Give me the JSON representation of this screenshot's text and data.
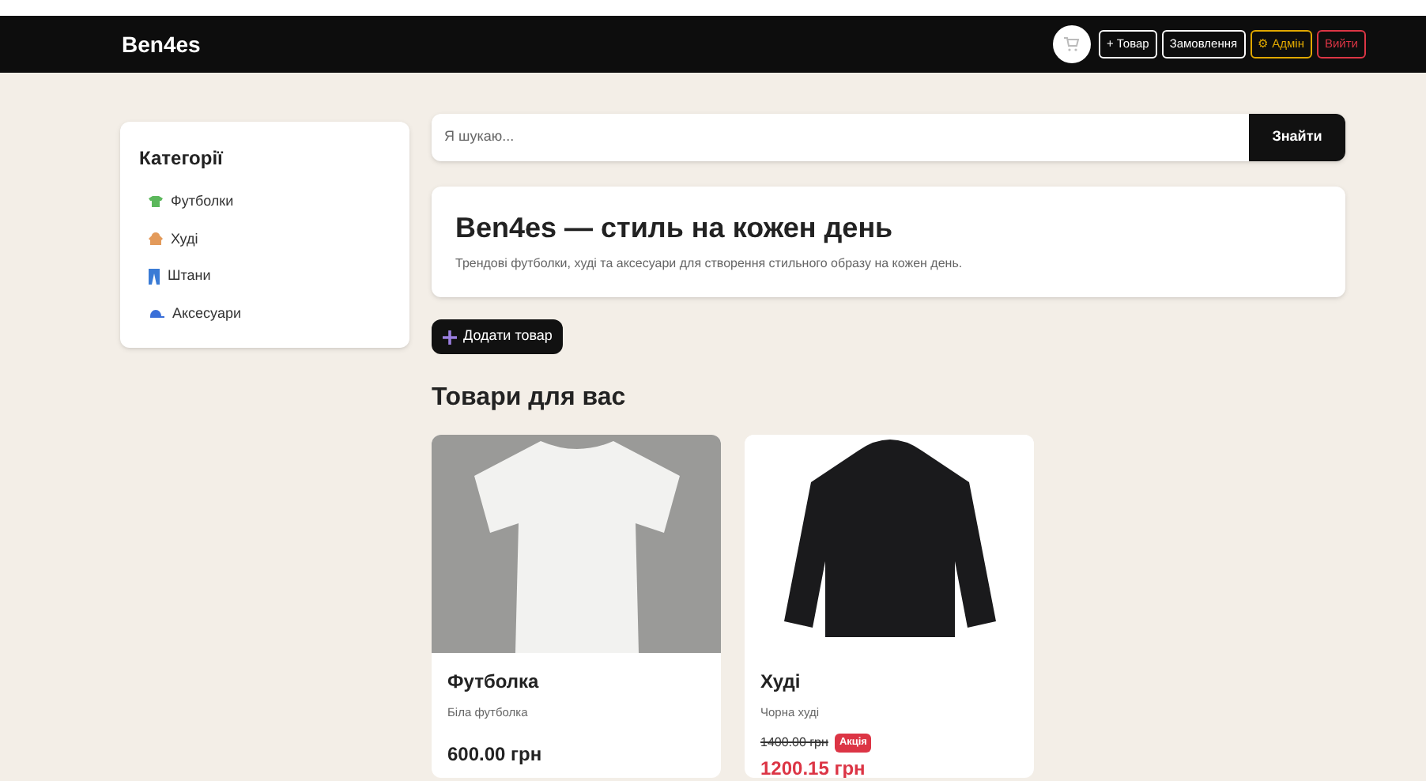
{
  "navbar": {
    "brand": "Ben4es",
    "buttons": [
      {
        "label": "+ Товар",
        "color": "#ffffff"
      },
      {
        "label": "Замовлення",
        "color": "#ffffff"
      },
      {
        "label": "⚙ Адмін",
        "color": "#e0a800"
      },
      {
        "label": "Вийти",
        "color": "#dc3545"
      }
    ]
  },
  "sidebar": {
    "title": "Категорії",
    "items": [
      {
        "label": "Футболки"
      },
      {
        "label": "Худі"
      },
      {
        "label": "Штани"
      },
      {
        "label": "Аксесуари"
      }
    ]
  },
  "search": {
    "placeholder": "Я шукаю...",
    "button": "Знайти"
  },
  "hero": {
    "title": "Ben4es — стиль на кожен день",
    "subtitle": "Трендові футболки, худі та аксесуари для створення стильного образу на кожен день."
  },
  "add_button": "Додати товар",
  "section_title": "Товари для вас",
  "products": [
    {
      "kind": "regular",
      "name": "Футболка",
      "description": "Біла футболка",
      "price": "600.00 грн"
    },
    {
      "kind": "sale",
      "name": "Худі",
      "description": "Чорна худі",
      "old_price": "1400.00 грн",
      "badge": "Акція",
      "price": "1200.15 грн"
    }
  ]
}
